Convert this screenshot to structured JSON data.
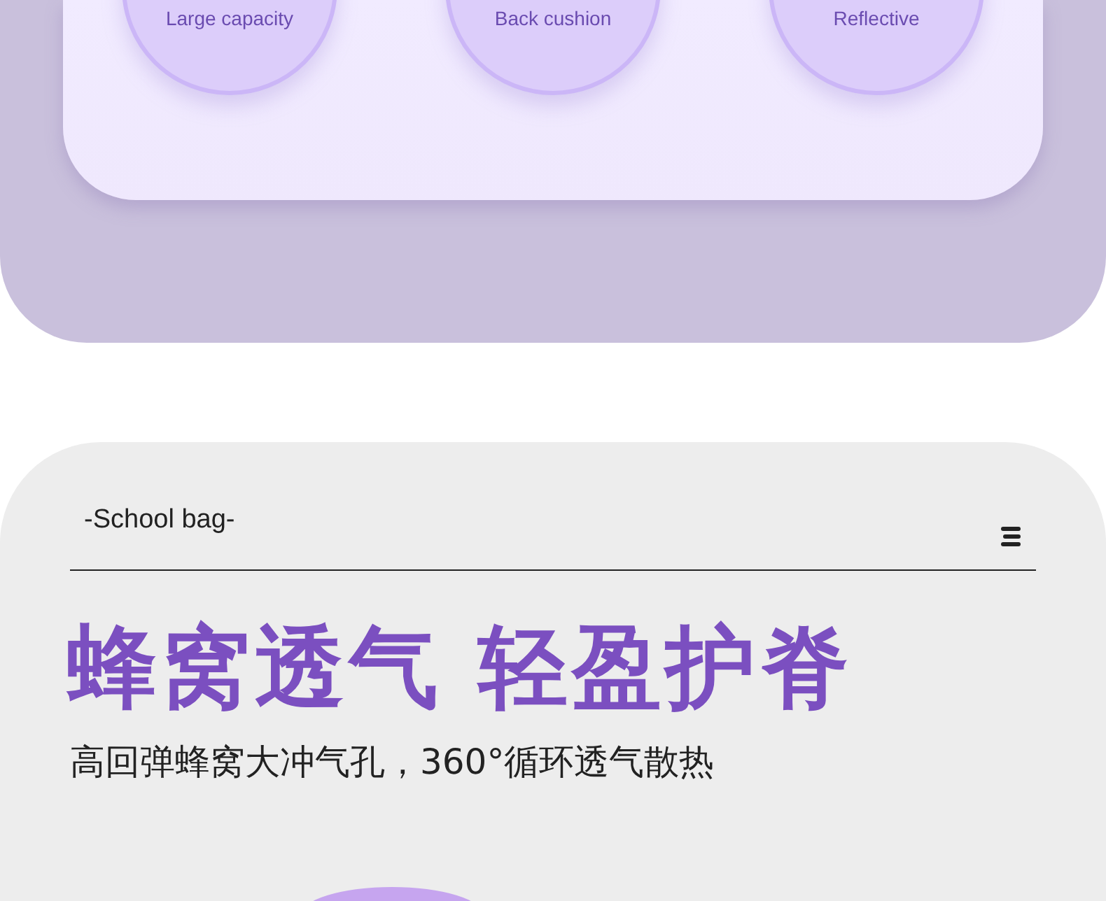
{
  "features": [
    {
      "label": "Large capacity"
    },
    {
      "label": "Back cushion"
    },
    {
      "label": "Reflective"
    }
  ],
  "section": {
    "label": "-School bag-",
    "heading": "蜂窝透气 轻盈护脊",
    "subheading": "高回弹蜂窝大冲气孔，360°循环透气散热"
  }
}
